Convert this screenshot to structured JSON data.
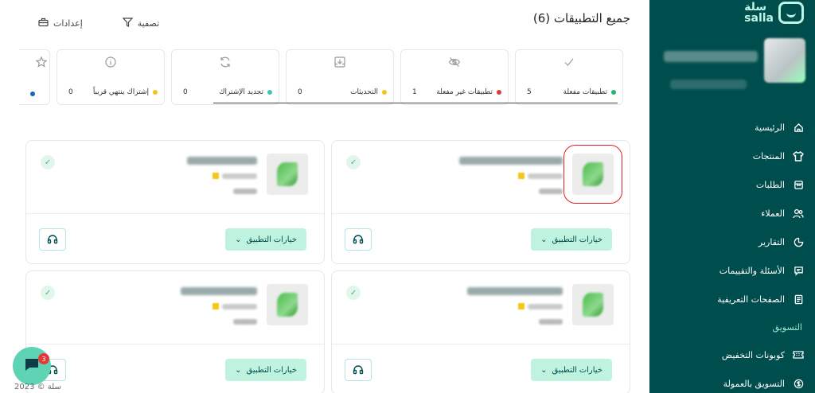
{
  "brand": {
    "logo_ar": "سلة",
    "logo_en": "salla"
  },
  "sidebar": {
    "items": [
      {
        "label": "الرئيسية",
        "icon": "home-icon"
      },
      {
        "label": "المنتجات",
        "icon": "shirt-icon"
      },
      {
        "label": "الطلبات",
        "icon": "orders-icon"
      },
      {
        "label": "العملاء",
        "icon": "users-icon"
      },
      {
        "label": "التقارير",
        "icon": "pie-chart-icon"
      },
      {
        "label": "الأسئلة والتقييمات",
        "icon": "chat-icon"
      },
      {
        "label": "الصفحات التعريفية",
        "icon": "pages-icon"
      }
    ],
    "section_marketing": "التسويق",
    "marketing_items": [
      {
        "label": "كوبونات التخفيض",
        "icon": "ticket-icon"
      },
      {
        "label": "التسويق بالعمولة",
        "icon": "dollar-icon"
      }
    ]
  },
  "header": {
    "title": "جميع التطبيقات (6)",
    "filter_label": "تصفية",
    "settings_label": "إعدادات"
  },
  "stats": [
    {
      "label": "تطبيقات مفعلة",
      "value": "5",
      "dot": "#22b573",
      "icon": "check-icon"
    },
    {
      "label": "تطبيقات غير مفعلة",
      "value": "1",
      "dot": "#e53935",
      "icon": "eye-off-icon"
    },
    {
      "label": "التحديثات",
      "value": "0",
      "dot": "#f5c518",
      "icon": "download-icon"
    },
    {
      "label": "تجديد الإشتراك",
      "value": "0",
      "dot": "#3cc8b4",
      "icon": "refresh-icon"
    },
    {
      "label": "إشتراك ينتهي قريباً",
      "value": "0",
      "dot": "#f5c518",
      "icon": "info-icon"
    },
    {
      "label": "",
      "value": "",
      "dot": "#1565c0",
      "icon": "star-icon"
    }
  ],
  "cards": {
    "options_label": "خيارات التطبيق",
    "apps": [
      "app-1",
      "app-2",
      "app-3",
      "app-4"
    ]
  },
  "chat": {
    "badge": "3"
  },
  "footer": {
    "text": "سلة © 2023"
  }
}
